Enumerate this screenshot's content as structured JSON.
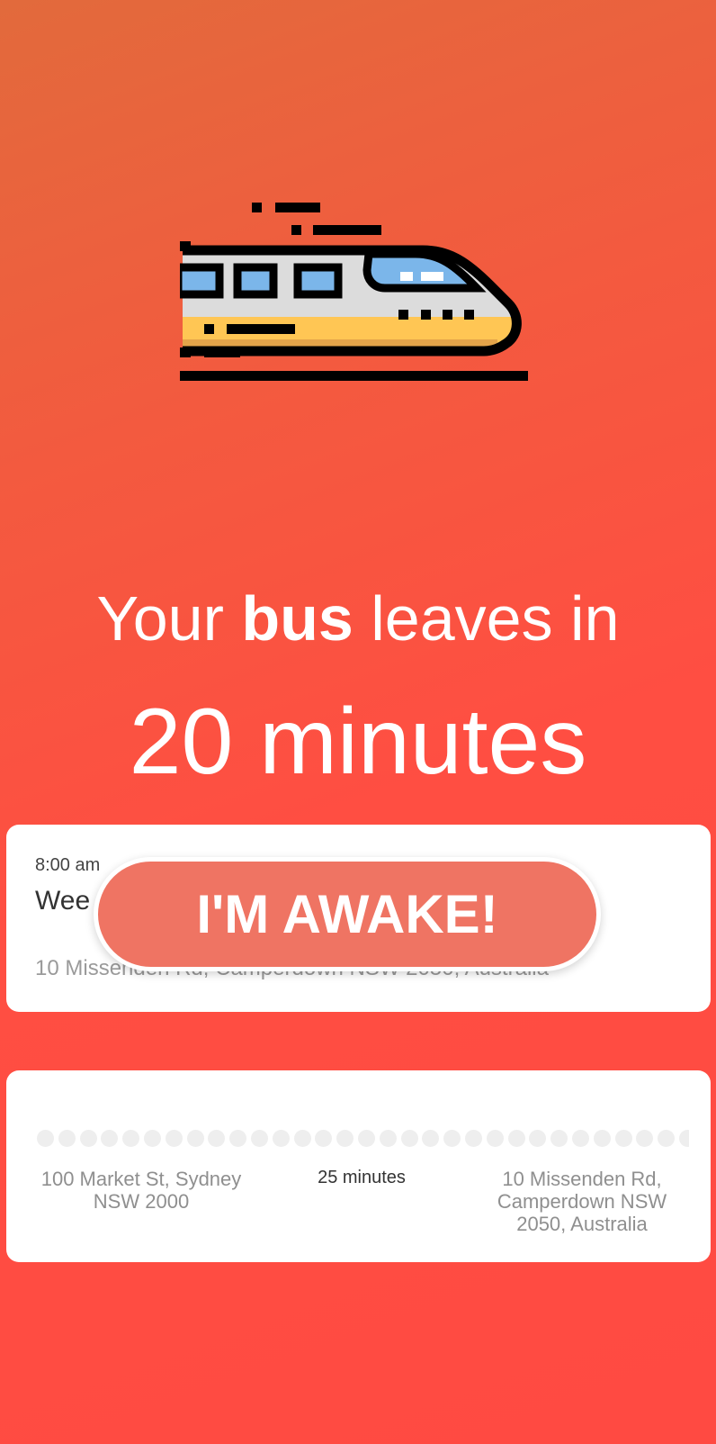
{
  "hero": {
    "icon": "train-icon",
    "headline_prefix": "Your",
    "headline_bold": "bus",
    "headline_suffix": "leaves in",
    "countdown": "20 minutes"
  },
  "alarm_card": {
    "time": "8:00 am",
    "name": "Wee",
    "address": "10 Missenden Rd, Camperdown NSW 2050, Australia"
  },
  "awake_button": {
    "label": "I'M AWAKE!"
  },
  "route_card": {
    "from": "100 Market St, Sydney NSW 2000",
    "duration": "25 minutes",
    "to": "10 Missenden Rd, Camperdown NSW 2050, Australia"
  },
  "colors": {
    "background_top": "#e26a3c",
    "background_bottom": "#ff4a42",
    "button": "#ef7463",
    "card": "#ffffff",
    "dot": "#eeeeee"
  }
}
